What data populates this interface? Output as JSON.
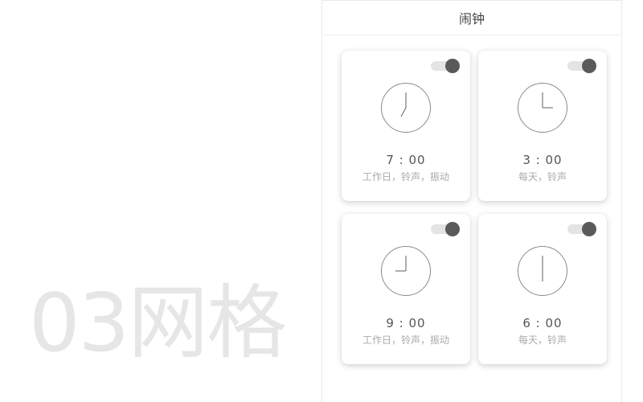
{
  "page": {
    "label": "03网格"
  },
  "nav": {
    "title": "闹钟"
  },
  "alarms": [
    {
      "time": "7 : 00",
      "desc": "工作日，铃声，振动",
      "enabled": true
    },
    {
      "time": "3 : 00",
      "desc": "每天，铃声",
      "enabled": true
    },
    {
      "time": "9 : 00",
      "desc": "工作日，铃声，振动",
      "enabled": true
    },
    {
      "time": "6 : 00",
      "desc": "每天，铃声",
      "enabled": true
    }
  ],
  "colors": {
    "toggle_knob": "#5a5a5a",
    "toggle_track": "#e4e4e4",
    "label_gray": "#e6e6e6"
  },
  "icons": {
    "clock": "clock-icon"
  }
}
